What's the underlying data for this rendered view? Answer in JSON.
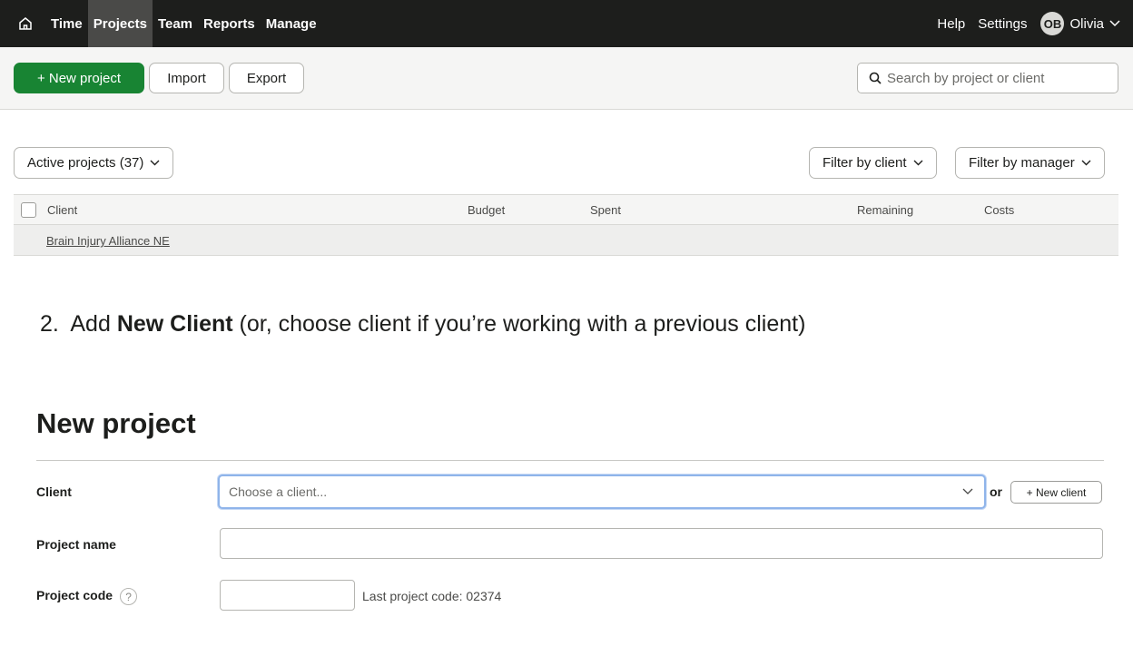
{
  "nav": {
    "items": [
      {
        "label": "Time",
        "active": false
      },
      {
        "label": "Projects",
        "active": true
      },
      {
        "label": "Team",
        "active": false
      },
      {
        "label": "Reports",
        "active": false
      },
      {
        "label": "Manage",
        "active": false
      }
    ],
    "help": "Help",
    "settings": "Settings",
    "avatar_initials": "OB",
    "user_name": "Olivia"
  },
  "toolbar": {
    "new_project": "+ New project",
    "import": "Import",
    "export": "Export",
    "search_placeholder": "Search by project or client"
  },
  "filters": {
    "status": "Active projects (37)",
    "client": "Filter by client",
    "manager": "Filter by manager"
  },
  "table": {
    "columns": [
      "Client",
      "Budget",
      "Spent",
      "Remaining",
      "Costs"
    ],
    "rows": [
      {
        "client": "Brain Injury Alliance NE"
      }
    ]
  },
  "instruction": {
    "number": "2.",
    "prefix": "Add ",
    "bold": "New Client",
    "suffix": " (or, choose client if you’re working with a previous client)"
  },
  "form": {
    "title": "New project",
    "client_label": "Client",
    "client_placeholder": "Choose a client...",
    "or": "or",
    "new_client": "+ New client",
    "project_name_label": "Project name",
    "project_code_label": "Project code",
    "help_glyph": "?",
    "last_code": "Last project code: 02374"
  },
  "colors": {
    "nav_bg": "#1d1e1c",
    "primary_green": "#188433",
    "focus_blue": "#8fb4ea"
  }
}
